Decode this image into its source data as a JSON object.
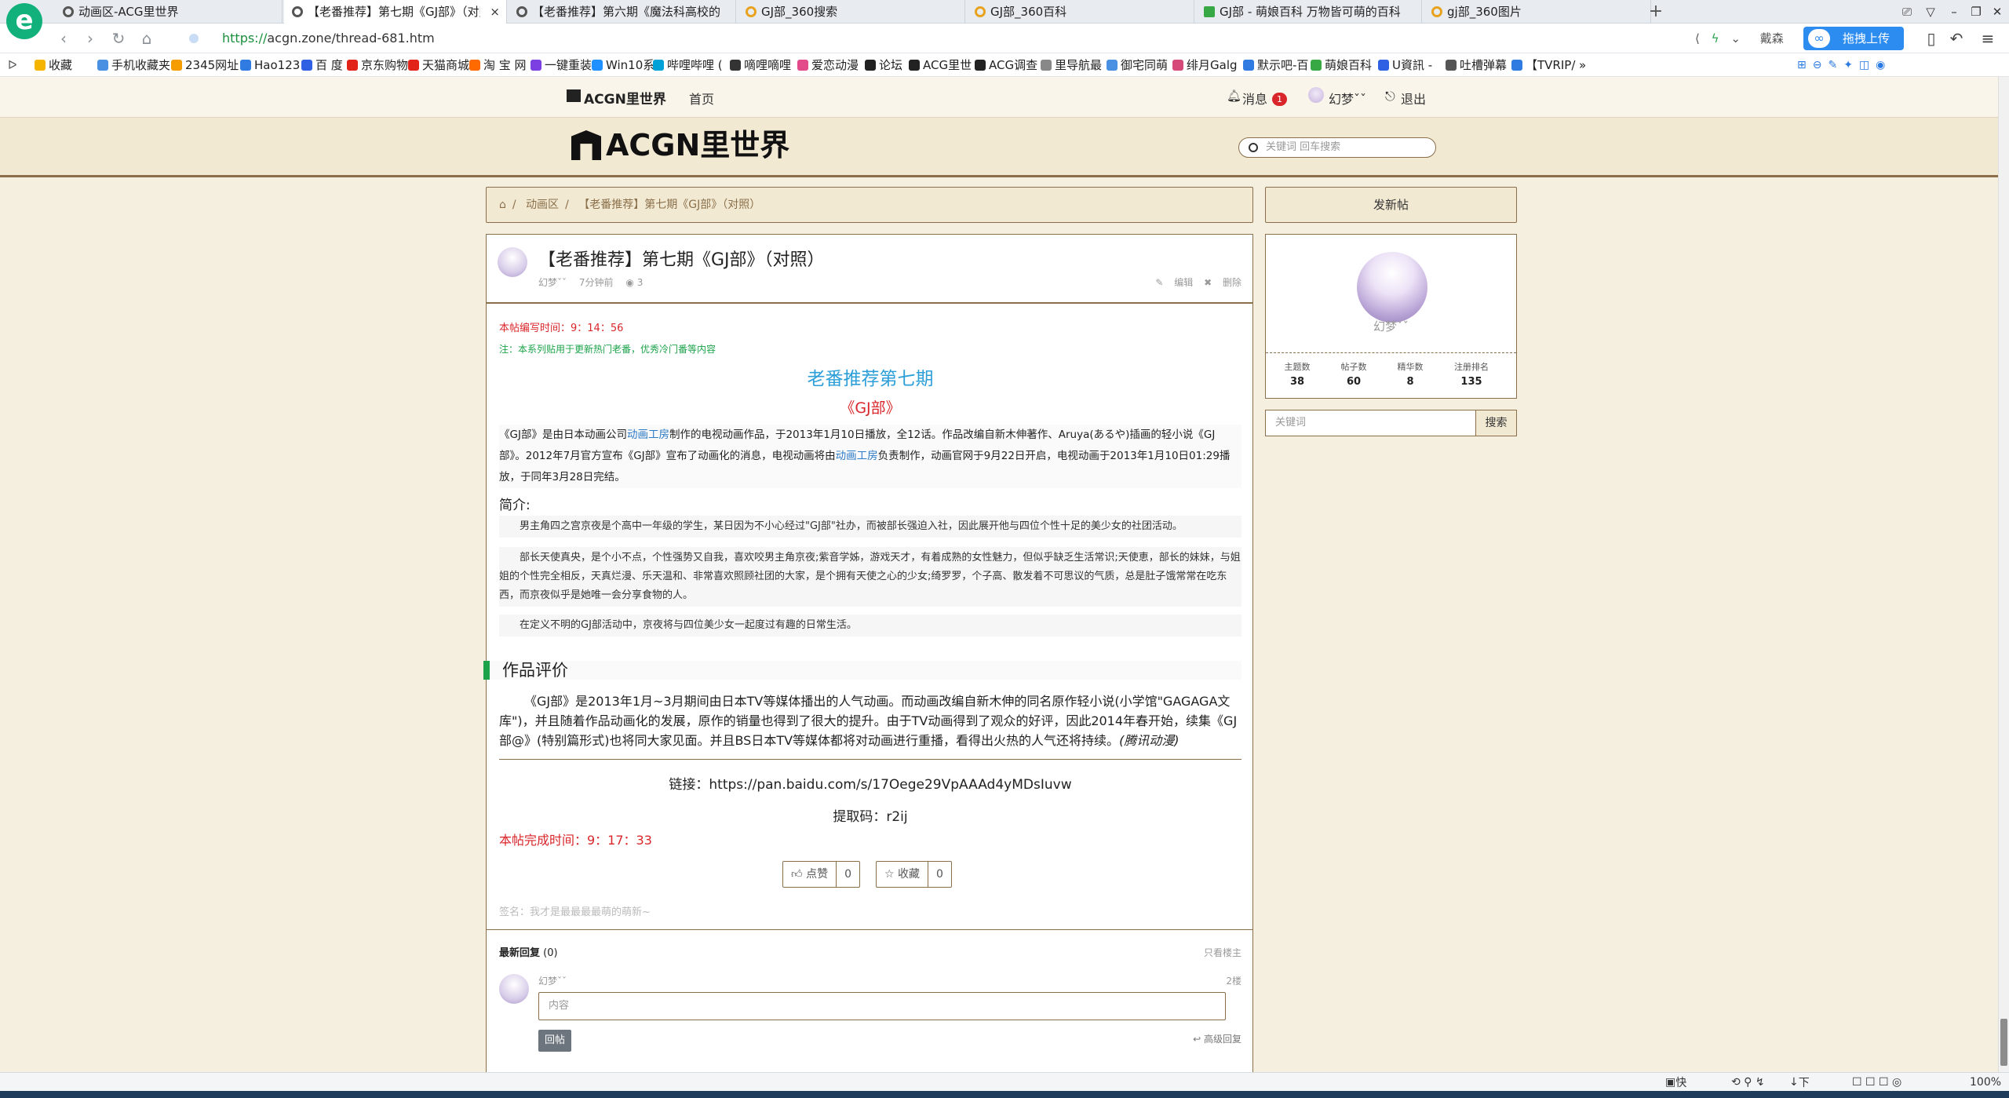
{
  "browser": {
    "tabs": [
      {
        "title": "动画区-ACG里世界",
        "active": false
      },
      {
        "title": "【老番推荐】第七期《GJ部》（对照）",
        "active": true
      },
      {
        "title": "【老番推荐】第六期《魔法科高校的",
        "active": false
      },
      {
        "title": "GJ部_360搜索",
        "active": false
      },
      {
        "title": "GJ部_360百科",
        "active": false
      },
      {
        "title": "GJ部 - 萌娘百科 万物皆可萌的百科",
        "active": false
      },
      {
        "title": "gj部_360图片",
        "active": false
      }
    ],
    "tab_close": "×",
    "new_tab": "+",
    "url_scheme": "https://",
    "url_rest": "acgn.zone/thread-681.htm",
    "addr_right_text": "戴森",
    "upload_label": "拖拽上传",
    "bookmarks": [
      {
        "label": "收藏",
        "color": "#f5b400"
      },
      {
        "label": "手机收藏夹",
        "color": "#4a90e2"
      },
      {
        "label": "2345网址",
        "color": "#f59c00"
      },
      {
        "label": "Hao123",
        "color": "#2f7be2"
      },
      {
        "label": "百 度",
        "color": "#2f5fe2"
      },
      {
        "label": "京东购物",
        "color": "#e2231a"
      },
      {
        "label": "天猫商城",
        "color": "#e2231a"
      },
      {
        "label": "淘 宝 网",
        "color": "#ff6a00"
      },
      {
        "label": "一键重装",
        "color": "#7b3fe2"
      },
      {
        "label": "Win10系",
        "color": "#1e90ff"
      },
      {
        "label": "哔哩哔哩 (",
        "color": "#00a1d6"
      },
      {
        "label": "嘀哩嘀哩",
        "color": "#333333"
      },
      {
        "label": "爱恋动漫",
        "color": "#e24a8a"
      },
      {
        "label": "论坛",
        "color": "#222222"
      },
      {
        "label": "ACG里世",
        "color": "#222222"
      },
      {
        "label": "ACG调查",
        "color": "#222222"
      },
      {
        "label": "里导航最",
        "color": "#888888"
      },
      {
        "label": "御宅同萌",
        "color": "#4a90e2"
      },
      {
        "label": "绯月Galg",
        "color": "#d64a7a"
      },
      {
        "label": "默示吧-百",
        "color": "#2f7be2"
      },
      {
        "label": "萌娘百科",
        "color": "#38a845"
      },
      {
        "label": "U資訊 -",
        "color": "#2f5fe2"
      },
      {
        "label": "吐槽弹幕",
        "color": "#555555"
      },
      {
        "label": "【TVRIP/",
        "color": "#2f7be2"
      }
    ],
    "bookmarks_more": "»",
    "status_bar": {
      "clipboard": "快剪辑",
      "download": "下载",
      "zoom": "100%"
    }
  },
  "site": {
    "brand": "ACGN里世界",
    "nav_home": "首页",
    "messages_label": "消息",
    "messages_count": "1",
    "username": "幻梦ˇˇ",
    "logout": "退出",
    "big_logo": "ACGN里世界",
    "search_placeholder": "关键词 回车搜索"
  },
  "breadcrumb": {
    "home_icon": "home-icon",
    "section": "动画区",
    "current": "【老番推荐】第七期《GJ部》（对照）"
  },
  "post": {
    "title": "【老番推荐】第七期《GJ部》（对照）",
    "author": "幻梦ˇˇ",
    "time": "7分钟前",
    "views": "3",
    "edit": "编辑",
    "delete": "删除",
    "written_time": "本帖编写时间：9：14：56",
    "note": "注：本系列贴用于更新热门老番，优秀冷门番等内容",
    "heading": "老番推荐第七期",
    "subheading": "《GJ部》",
    "intro_1": "《GJ部》是由日本动画公司",
    "intro_link_1": "动画工房",
    "intro_2": "制作的电视动画作品，于2013年1月10日播放，全12话。作品改编自新木伸著作、Aruya(あるや)插画的轻小说《GJ部》。2012年7月官方宣布《GJ部》宣布了动画化的消息，电视动画将由",
    "intro_link_2": "动画工房",
    "intro_3": "负责制作，动画官网于9月22日开启，电视动画于2013年1月10日01:29播放，于同年3月28日完结。",
    "synopsis_label": "简介:",
    "synopsis_1": "男主角四之宫京夜是个高中一年级的学生，某日因为不小心经过\"GJ部\"社办，而被部长强迫入社，因此展开他与四位个性十足的美少女的社团活动。",
    "synopsis_2": "部长天使真央，是个小不点，个性强势又自我，喜欢咬男主角京夜;紫音学姊，游戏天才，有着成熟的女性魅力，但似乎缺乏生活常识;天使恵，部长的妹妹，与姐姐的个性完全相反，天真烂漫、乐天温和、非常喜欢照顾社团的大家，是个拥有天使之心的少女;绮罗罗，个子高、散发着不可思议的气质，总是肚子饿常常在吃东西，而京夜似乎是她唯一会分享食物的人。",
    "synopsis_3": "在定义不明的GJ部活动中，京夜将与四位美少女一起度过有趣的日常生活。",
    "review_heading": "作品评价",
    "review": "《GJ部》是2013年1月~3月期间由日本TV等媒体播出的人气动画。而动画改编自新木伸的同名原作轻小说(小学馆\"GAGAGA文库\")，并且随着作品动画化的发展，原作的销量也得到了很大的提升。由于TV动画得到了观众的好评，因此2014年春开始，续集《GJ部@》(特别篇形式)也将同大家见面。并且BS日本TV等媒体都将对动画进行重播，看得出火热的人气还将持续。",
    "review_source": "(腾讯动漫)",
    "link_line": "链接：https://pan.baidu.com/s/17Oege29VpAAAd4yMDsIuvw",
    "code_line": "提取码：r2ij",
    "finished_time": "本帖完成时间：9：17：33",
    "like_label": "点赞",
    "like_count": "0",
    "fav_label": "收藏",
    "fav_count": "0",
    "signature": "签名：我才是最最最最萌的萌新~"
  },
  "replies": {
    "header": "最新回复",
    "count": "(0)",
    "only_op": "只看楼主",
    "user": "幻梦ˇˇ",
    "floor": "2楼",
    "placeholder": "内容",
    "submit": "回帖",
    "advanced": "高级回复"
  },
  "sidebar": {
    "new_thread": "发新帖",
    "username": "幻梦ˇˇ",
    "stats": [
      {
        "label": "主题数",
        "value": "38"
      },
      {
        "label": "帖子数",
        "value": "60"
      },
      {
        "label": "精华数",
        "value": "8"
      },
      {
        "label": "注册排名",
        "value": "135"
      }
    ],
    "search_placeholder": "关键词",
    "search_button": "搜索"
  },
  "colors": {
    "accent_brown": "#8a6f4a",
    "accent_blue": "#2d9fd8",
    "accent_red": "#d9262b",
    "accent_green": "#1ca34a"
  }
}
